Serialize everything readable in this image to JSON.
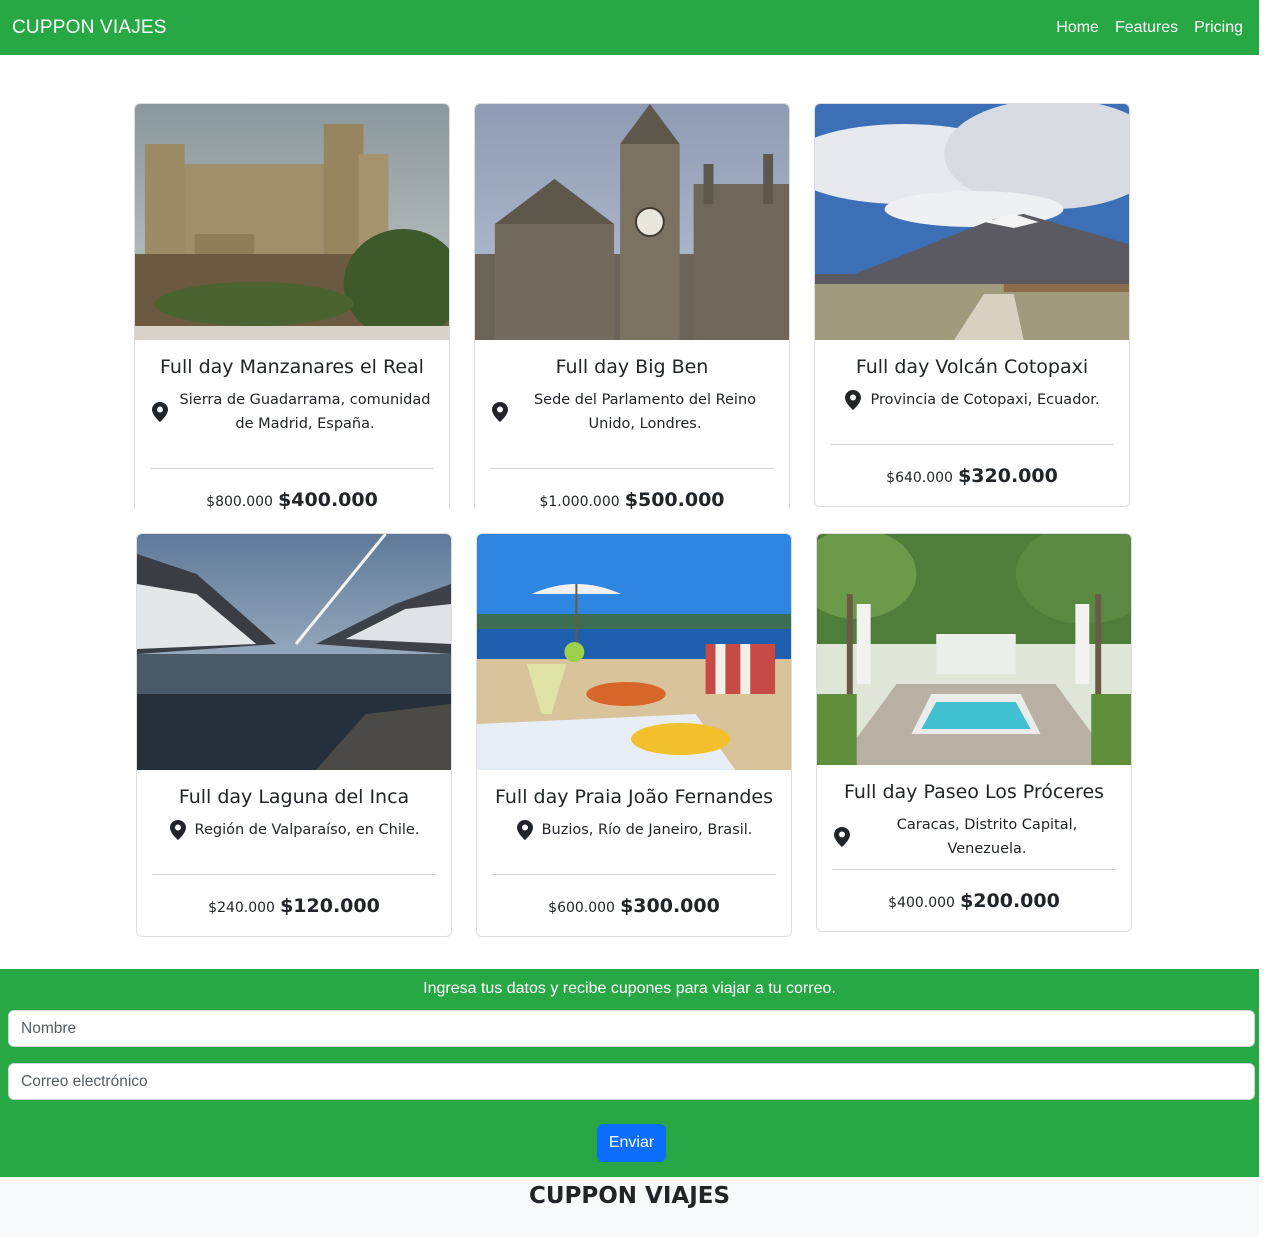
{
  "navbar": {
    "brand": "CUPPON VIAJES",
    "links": [
      "Home",
      "Features",
      "Pricing"
    ]
  },
  "cards": [
    {
      "title": "Full day Manzanares el Real",
      "location": "Sierra de Guadarrama, comunidad de Madrid, España.",
      "old_price": "$800.000",
      "new_price": "$400.000"
    },
    {
      "title": "Full day Big Ben",
      "location": "Sede del Parlamento del Reino Unido, Londres.",
      "old_price": "$1.000.000",
      "new_price": "$500.000"
    },
    {
      "title": "Full day Volcán Cotopaxi",
      "location": "Provincia de Cotopaxi, Ecuador.",
      "old_price": "$640.000",
      "new_price": "$320.000"
    },
    {
      "title": "Full day Laguna del Inca",
      "location": "Región de Valparaíso, en Chile.",
      "old_price": "$240.000",
      "new_price": "$120.000"
    },
    {
      "title": "Full day Praia João Fernandes",
      "location": "Buzios, Río de Janeiro, Brasil.",
      "old_price": "$600.000",
      "new_price": "$300.000"
    },
    {
      "title": "Full day Paseo Los Próceres",
      "location": "Caracas, Distrito Capital, Venezuela.",
      "old_price": "$400.000",
      "new_price": "$200.000"
    }
  ],
  "signup": {
    "text": "Ingresa tus datos y recibe cupones para viajar a tu correo.",
    "name_placeholder": "Nombre",
    "email_placeholder": "Correo electrónico",
    "submit_label": "Enviar"
  },
  "footer": {
    "brand": "CUPPON VIAJES"
  },
  "colors": {
    "primary_green": "#28a745",
    "button_blue": "#0d6efd"
  }
}
